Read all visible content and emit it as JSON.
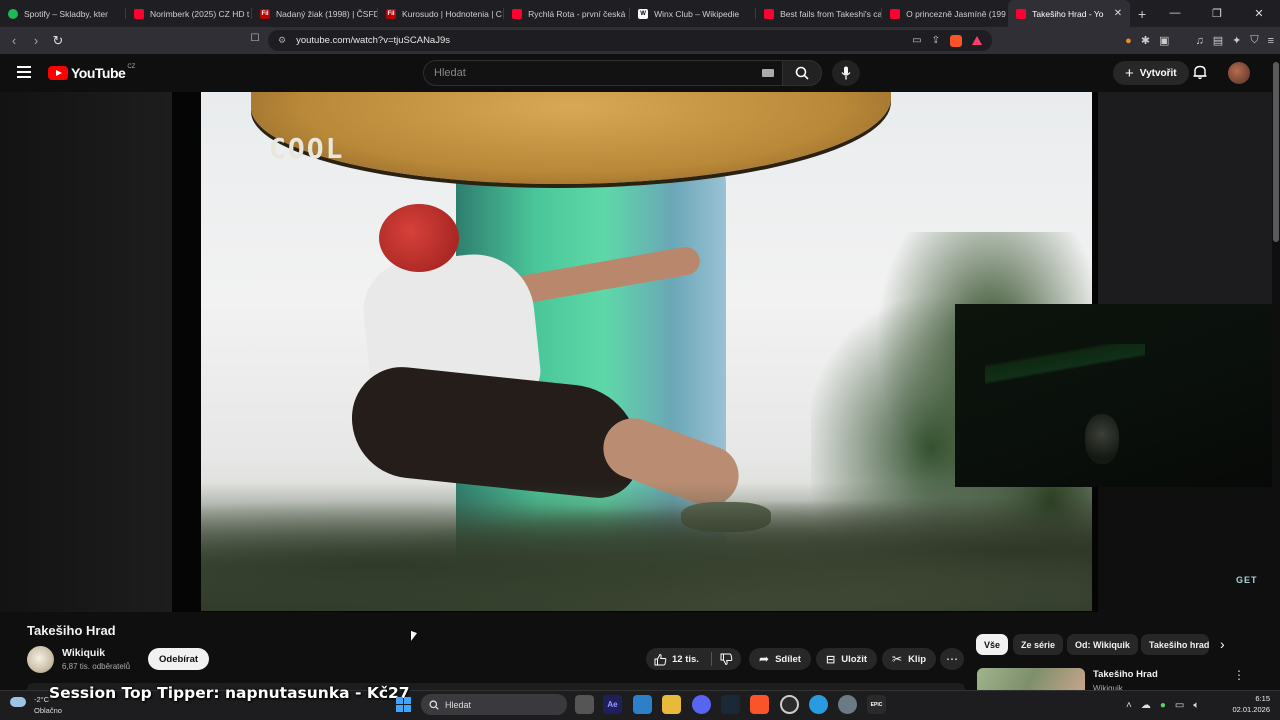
{
  "browser": {
    "tabs": [
      {
        "label": "Spotify – Skladby, kter",
        "favicon": "spotify"
      },
      {
        "label": "Norimberk (2025) CZ HD t",
        "favicon": "youtube"
      },
      {
        "label": "Nadaný žiak (1998) | ČSFD",
        "favicon": "csfd"
      },
      {
        "label": "Kurosudo | Hodnotenia | C",
        "favicon": "csfd"
      },
      {
        "label": "Rychlá Rota - první česká",
        "favicon": "youtube"
      },
      {
        "label": "Winx Club – Wikipedie",
        "favicon": "wikipedia"
      },
      {
        "label": "Best fails from Takeshi's ca",
        "favicon": "youtube"
      },
      {
        "label": "O princezně Jasmíně (199",
        "favicon": "youtube"
      },
      {
        "label": "Takešiho Hrad - Yo",
        "favicon": "youtube",
        "active": true
      }
    ],
    "new_tab": "+",
    "url": "youtube.com/watch?v=tjuSCANaJ9s"
  },
  "youtube": {
    "logo": "YouTube",
    "region": "CZ",
    "search_placeholder": "Hledat",
    "create_label": "Vytvořit"
  },
  "video": {
    "overlay_text": "COOL",
    "corner_logo": "GET",
    "title": "Takešiho Hrad",
    "channel": "Wikiquik",
    "subscribers": "6,87 tis. odběratelů",
    "subscribe_label": "Odebírat",
    "likes": "12 tis.",
    "share_label": "Sdílet",
    "save_label": "Uložit",
    "clip_label": "Klip"
  },
  "sidebar": {
    "chips": [
      "Vše",
      "Ze série",
      "Od: Wikiquik",
      "Takešiho hrad"
    ],
    "recommendation": {
      "title": "Takešiho Hrad",
      "channel": "Wikiquik"
    }
  },
  "stream_overlay": "Session Top Tipper: napnutasunka - Kč27",
  "taskbar": {
    "weather_temp": "-2°C",
    "weather_condition": "Oblačno",
    "search_placeholder": "Hledat",
    "time": "6:15",
    "date": "02.01.2026"
  },
  "colors": {
    "yt_red": "#ff0000",
    "background": "#0f0f0f",
    "pill": "#272727",
    "accent_blue": "#3ea6ff"
  }
}
